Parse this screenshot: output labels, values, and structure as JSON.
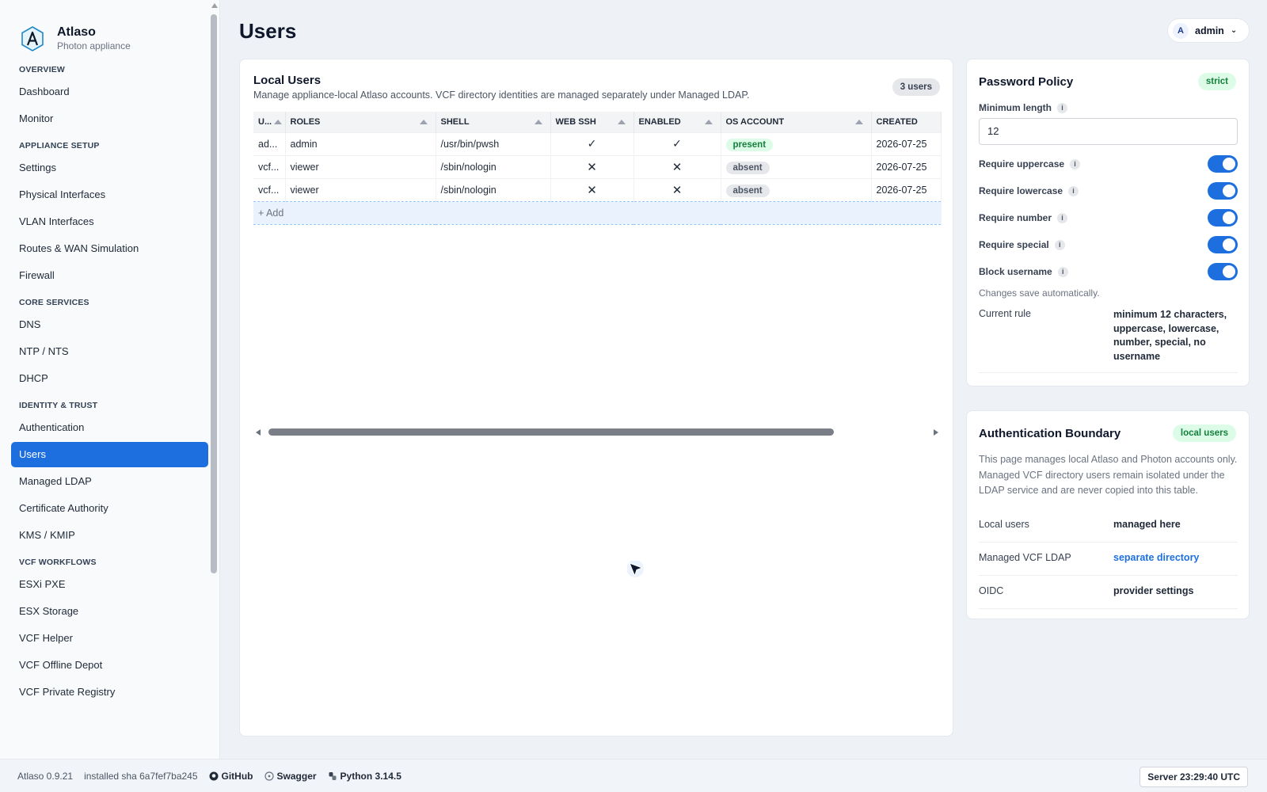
{
  "brand": {
    "name": "Atlaso",
    "subtitle": "Photon appliance"
  },
  "nav": {
    "sections": [
      {
        "title": "OVERVIEW",
        "items": [
          "Dashboard",
          "Monitor"
        ]
      },
      {
        "title": "APPLIANCE SETUP",
        "items": [
          "Settings",
          "Physical Interfaces",
          "VLAN Interfaces",
          "Routes & WAN Simulation",
          "Firewall"
        ]
      },
      {
        "title": "CORE SERVICES",
        "items": [
          "DNS",
          "NTP / NTS",
          "DHCP"
        ]
      },
      {
        "title": "IDENTITY & TRUST",
        "items": [
          "Authentication",
          "Users",
          "Managed LDAP",
          "Certificate Authority",
          "KMS / KMIP"
        ]
      },
      {
        "title": "VCF WORKFLOWS",
        "items": [
          "ESXi PXE",
          "ESX Storage",
          "VCF Helper",
          "VCF Offline Depot",
          "VCF Private Registry"
        ]
      }
    ],
    "active": "Users"
  },
  "header": {
    "title": "Users",
    "user_initial": "A",
    "user_name": "admin"
  },
  "local_users": {
    "title": "Local Users",
    "description": "Manage appliance-local Atlaso accounts. VCF directory identities are managed separately under Managed LDAP.",
    "count_badge": "3 users",
    "columns": [
      "U...",
      "ROLES",
      "SHELL",
      "WEB SSH",
      "ENABLED",
      "OS ACCOUNT",
      "CREATED"
    ],
    "rows": [
      {
        "user": "ad...",
        "roles": "admin",
        "shell": "/usr/bin/pwsh",
        "web_ssh": "✓",
        "enabled": "✓",
        "os_account": "present",
        "created": "2026-07-25"
      },
      {
        "user": "vcf...",
        "roles": "viewer",
        "shell": "/sbin/nologin",
        "web_ssh": "✕",
        "enabled": "✕",
        "os_account": "absent",
        "created": "2026-07-25"
      },
      {
        "user": "vcf...",
        "roles": "viewer",
        "shell": "/sbin/nologin",
        "web_ssh": "✕",
        "enabled": "✕",
        "os_account": "absent",
        "created": "2026-07-25"
      }
    ],
    "add_label": "+ Add"
  },
  "password_policy": {
    "title": "Password Policy",
    "badge": "strict",
    "min_length_label": "Minimum length",
    "min_length_value": "12",
    "toggles": [
      {
        "label": "Require uppercase",
        "on": true
      },
      {
        "label": "Require lowercase",
        "on": true
      },
      {
        "label": "Require number",
        "on": true
      },
      {
        "label": "Require special",
        "on": true
      },
      {
        "label": "Block username",
        "on": true
      }
    ],
    "note": "Changes save automatically.",
    "current_rule_label": "Current rule",
    "current_rule_value": "minimum 12 characters, uppercase, lowercase, number, special, no username"
  },
  "auth_boundary": {
    "title": "Authentication Boundary",
    "badge": "local users",
    "description": "This page manages local Atlaso and Photon accounts only. Managed VCF directory users remain isolated under the LDAP service and are never copied into this table.",
    "rows": [
      {
        "key": "Local users",
        "value": "managed here"
      },
      {
        "key": "Managed VCF LDAP",
        "value": "separate directory"
      },
      {
        "key": "OIDC",
        "value": "provider settings"
      }
    ]
  },
  "footer": {
    "version": "Atlaso 0.9.21",
    "installed": "installed sha 6a7fef7ba245",
    "github": "GitHub",
    "swagger": "Swagger",
    "python": "Python 3.14.5",
    "server_time": "Server 23:29:40 UTC"
  },
  "colors": {
    "accent": "#1d6fe0",
    "success": "#16a34a",
    "danger": "#dc2626"
  }
}
